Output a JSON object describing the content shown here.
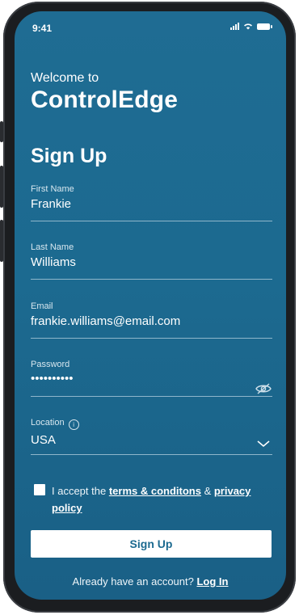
{
  "status_bar": {
    "time": "9:41"
  },
  "header": {
    "welcome": "Welcome to",
    "brand": "ControlEdge",
    "title": "Sign Up"
  },
  "form": {
    "first_name": {
      "label": "First Name",
      "value": "Frankie"
    },
    "last_name": {
      "label": "Last Name",
      "value": "Williams"
    },
    "email": {
      "label": "Email",
      "value": "frankie.williams@email.com"
    },
    "password": {
      "label": "Password",
      "value": "••••••••••"
    },
    "location": {
      "label": "Location",
      "value": "USA"
    }
  },
  "terms": {
    "prefix": "I accept the ",
    "terms_link": "terms & conditons",
    "middle": " & ",
    "privacy_link": "privacy policy"
  },
  "signup_button": "Sign Up",
  "login": {
    "prompt": "Already have an account? ",
    "link": "Log In"
  },
  "colors": {
    "background": "#1c6a90",
    "button_text": "#1c6a90",
    "frame": "#1b1d20"
  },
  "icons": [
    "signal-icon",
    "wifi-icon",
    "battery-icon",
    "eye-off-icon",
    "info-icon",
    "chevron-down-icon",
    "checkbox-icon"
  ]
}
